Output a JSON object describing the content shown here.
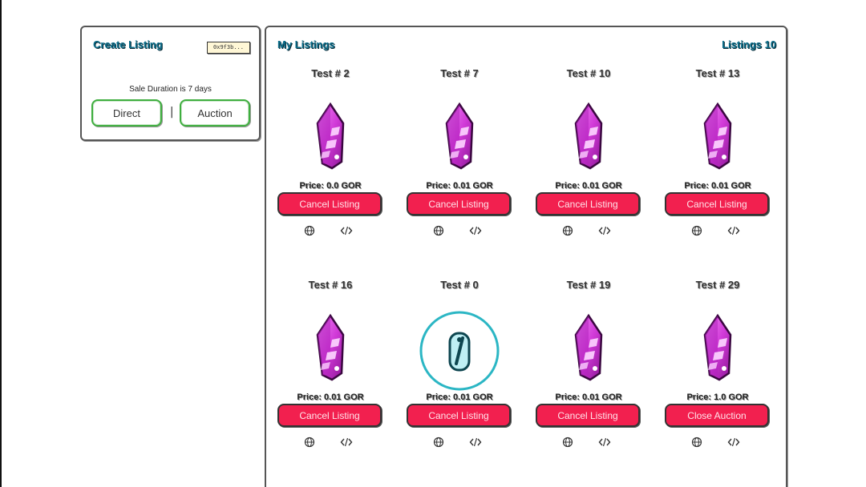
{
  "create_listing": {
    "title": "Create Listing",
    "wallet_chip": "0x9f3b...",
    "sale_duration": "Sale Duration is 7 days",
    "direct_label": "Direct",
    "separator": "|",
    "auction_label": "Auction"
  },
  "my_listings": {
    "title": "My Listings",
    "count_label": "Listings 10",
    "globe_icon": "globe-icon",
    "code_icon": "code-icon",
    "cards": [
      {
        "title": "Test # 2",
        "price": "Price: 0.0 GOR",
        "button": "Cancel Listing",
        "image": "crystal"
      },
      {
        "title": "Test # 7",
        "price": "Price: 0.01 GOR",
        "button": "Cancel Listing",
        "image": "crystal"
      },
      {
        "title": "Test # 10",
        "price": "Price: 0.01 GOR",
        "button": "Cancel Listing",
        "image": "crystal"
      },
      {
        "title": "Test # 13",
        "price": "Price: 0.01 GOR",
        "button": "Cancel Listing",
        "image": "crystal"
      },
      {
        "title": "Test # 16",
        "price": "Price: 0.01 GOR",
        "button": "Cancel Listing",
        "image": "crystal"
      },
      {
        "title": "Test # 0",
        "price": "Price: 0.01 GOR",
        "button": "Cancel Listing",
        "image": "medal"
      },
      {
        "title": "Test # 19",
        "price": "Price: 0.01 GOR",
        "button": "Cancel Listing",
        "image": "crystal"
      },
      {
        "title": "Test # 29",
        "price": "Price: 1.0 GOR",
        "button": "Close Auction",
        "image": "crystal"
      }
    ]
  },
  "colors": {
    "accent_title": "#0a6d8a",
    "cancel_button": "#f2204f",
    "crystal": "#d13ad8",
    "mode_border": "#3fae3f",
    "medal_ring": "#2bb6c4"
  }
}
